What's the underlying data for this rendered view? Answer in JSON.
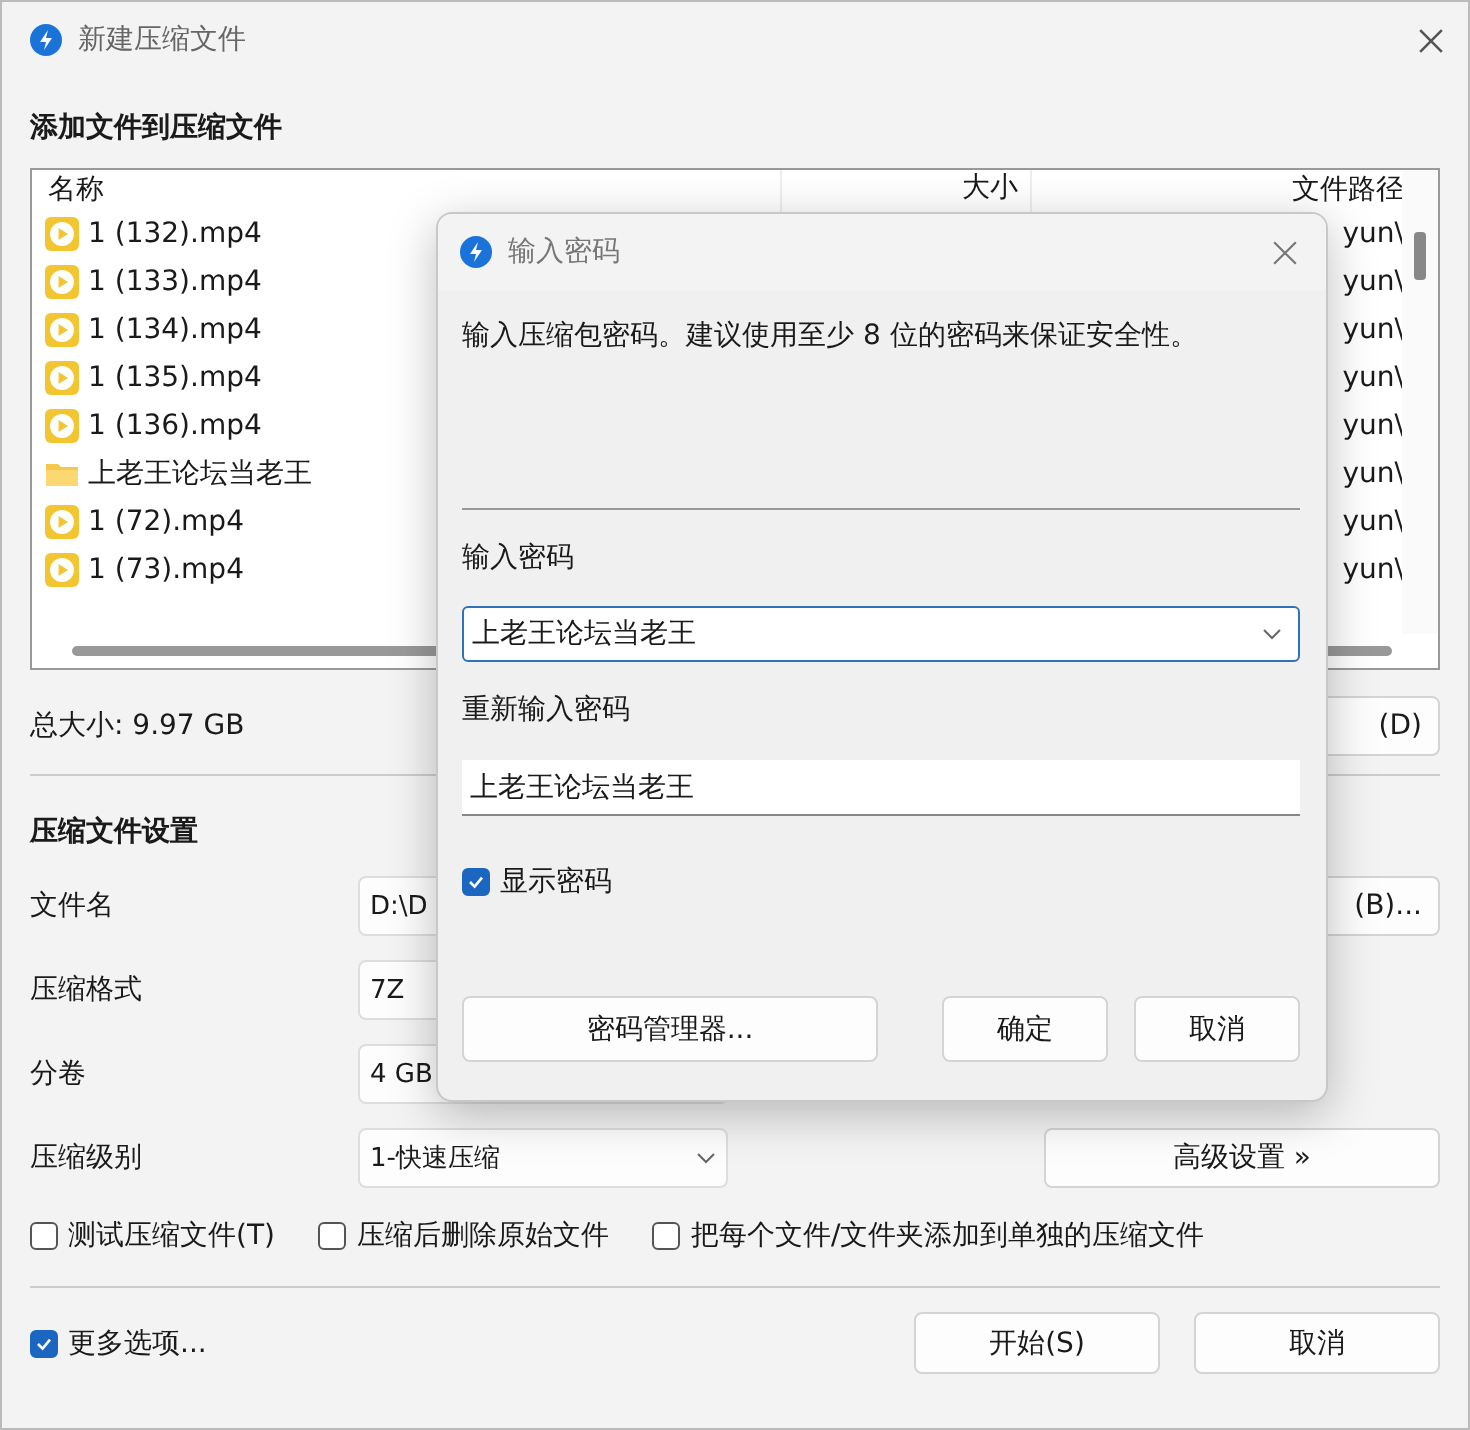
{
  "window": {
    "title": "新建压缩文件"
  },
  "files": {
    "heading": "添加文件到压缩文件",
    "columns": [
      "名称",
      "大小",
      "文件路径"
    ],
    "rows": [
      {
        "kind": "video",
        "name": "1 (132).mp4",
        "path": "yun\\"
      },
      {
        "kind": "video",
        "name": "1 (133).mp4",
        "path": "yun\\"
      },
      {
        "kind": "video",
        "name": "1 (134).mp4",
        "path": "yun\\"
      },
      {
        "kind": "video",
        "name": "1 (135).mp4",
        "path": "yun\\"
      },
      {
        "kind": "video",
        "name": "1 (136).mp4",
        "path": "yun\\"
      },
      {
        "kind": "folder",
        "name": "上老王论坛当老王",
        "path": "yun\\"
      },
      {
        "kind": "video",
        "name": "1 (72).mp4",
        "path": "yun\\"
      },
      {
        "kind": "video",
        "name": "1 (73).mp4",
        "path": "yun\\"
      }
    ]
  },
  "total_size": "总大小: 9.97 GB",
  "remove_button": "(D)",
  "settings": {
    "heading": "压缩文件设置",
    "fields": [
      {
        "kind": "text",
        "label": "文件名",
        "value": "D:\\D",
        "button": "(B)..."
      },
      {
        "kind": "box",
        "label": "压缩格式",
        "value": "7Z"
      },
      {
        "kind": "box",
        "label": "分卷",
        "value": "4 GB"
      },
      {
        "kind": "select",
        "label": "压缩级别",
        "value": "1-快速压缩",
        "button": "高级设置 »"
      }
    ],
    "options": [
      {
        "label": "测试压缩文件(T)",
        "checked": false
      },
      {
        "label": "压缩后删除原始文件",
        "checked": false
      },
      {
        "label": "把每个文件/文件夹添加到单独的压缩文件",
        "checked": false
      }
    ]
  },
  "more_options": {
    "label": "更多选项...",
    "checked": true
  },
  "buttons": [
    "开始(S)",
    "取消"
  ],
  "dialog": {
    "title": "输入密码",
    "message": "输入压缩包密码。建议使用至少 8 位的密码来保证安全性。",
    "password_label": "输入密码",
    "password": "上老王论坛当老王",
    "confirm_label": "重新输入密码",
    "confirm": "上老王论坛当老王",
    "show_password": {
      "label": "显示密码",
      "checked": true
    },
    "manager_button": "密码管理器...",
    "ok_button": "确定",
    "cancel_button": "取消"
  }
}
